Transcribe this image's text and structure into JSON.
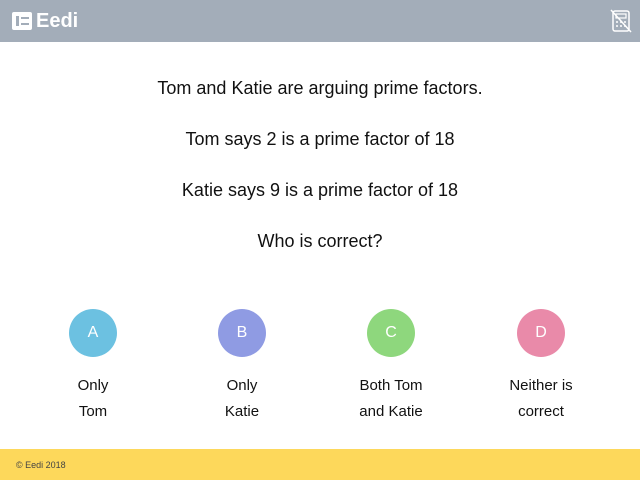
{
  "header": {
    "logo_text": "Eedi",
    "background": "#a3adb9",
    "calculator_icon": "calculator-disabled-icon"
  },
  "question": {
    "line1": "Tom and Katie are arguing prime factors.",
    "line2": "Tom says 2 is a prime factor of 18",
    "line3": "Katie says 9 is a prime factor of 18",
    "line4": "Who is correct?"
  },
  "options": [
    {
      "letter": "A",
      "text": "Only Tom",
      "color": "#6cc1e1"
    },
    {
      "letter": "B",
      "text": "Only Katie",
      "color": "#8f9be3"
    },
    {
      "letter": "C",
      "text": "Both Tom and Katie",
      "color": "#8ed77d"
    },
    {
      "letter": "D",
      "text": "Neither is correct",
      "color": "#e98aa9"
    }
  ],
  "footer": {
    "copyright": "© Eedi 2018",
    "background": "#fdd85b"
  }
}
